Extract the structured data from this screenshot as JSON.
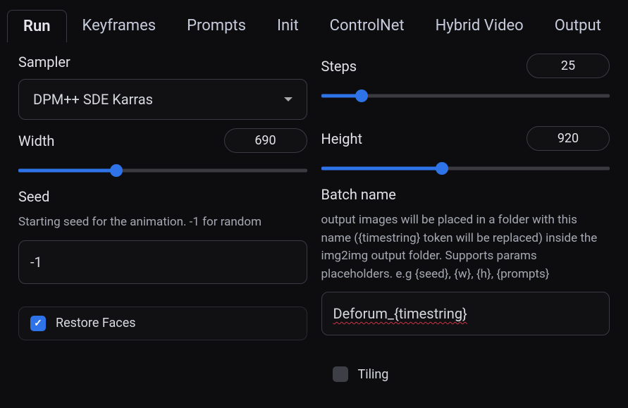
{
  "tabs": {
    "items": [
      "Run",
      "Keyframes",
      "Prompts",
      "Init",
      "ControlNet",
      "Hybrid Video",
      "Output"
    ],
    "active": 0
  },
  "sampler": {
    "label": "Sampler",
    "value": "DPM++ SDE Karras"
  },
  "steps": {
    "label": "Steps",
    "value": "25",
    "fillPct": 14
  },
  "width": {
    "label": "Width",
    "value": "690",
    "fillPct": 34
  },
  "height": {
    "label": "Height",
    "value": "920",
    "fillPct": 42
  },
  "seed": {
    "label": "Seed",
    "desc": "Starting seed for the animation. -1 for random",
    "value": "-1"
  },
  "batch": {
    "label": "Batch name",
    "desc": "output images will be placed in a folder with this name ({timestring} token will be replaced) inside the img2img output folder. Supports params placeholders. e.g {seed}, {w}, {h}, {prompts}",
    "value": "Deforum_{timestring}"
  },
  "restore": {
    "label": "Restore Faces",
    "checked": true
  },
  "tiling": {
    "label": "Tiling",
    "checked": false
  }
}
